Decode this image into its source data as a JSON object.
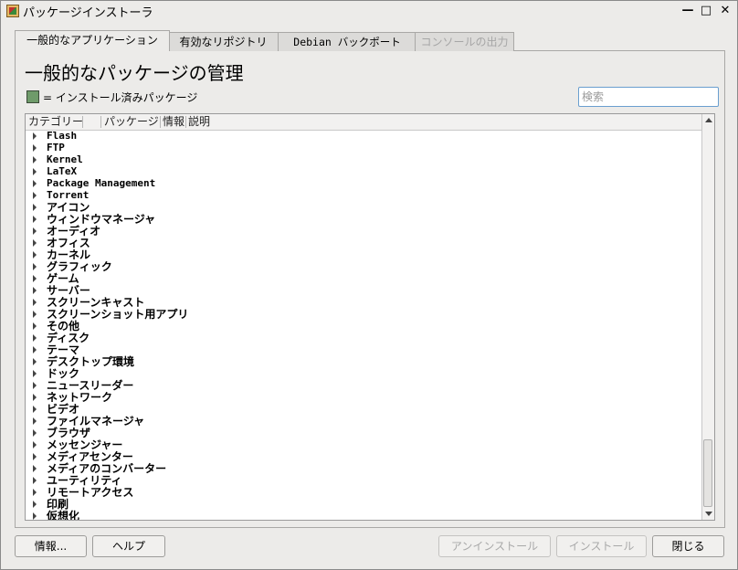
{
  "window": {
    "title": "パッケージインストーラ",
    "minimize_glyph": "—",
    "maximize_glyph": "□",
    "close_glyph": "✕"
  },
  "tabs": [
    {
      "label": "一般的なアプリケーション",
      "state": "active"
    },
    {
      "label": "有効なリポジトリ",
      "state": "normal"
    },
    {
      "label": "Debian バックポート",
      "state": "normal"
    },
    {
      "label": "コンソールの出力",
      "state": "disabled"
    }
  ],
  "main": {
    "page_title": "一般的なパッケージの管理",
    "legend_text": "= インストール済みパッケージ",
    "legend_color": "#6f9b6a",
    "search_placeholder": "検索",
    "search_value": ""
  },
  "tree": {
    "columns": [
      "カテゴリー",
      "パッケージ",
      "情報",
      "説明"
    ],
    "categories": [
      "Flash",
      "FTP",
      "Kernel",
      "LaTeX",
      "Package Management",
      "Torrent",
      "アイコン",
      "ウィンドウマネージャ",
      "オーディオ",
      "オフィス",
      "カーネル",
      "グラフィック",
      "ゲーム",
      "サーバー",
      "スクリーンキャスト",
      "スクリーンショット用アプリ",
      "その他",
      "ディスク",
      "テーマ",
      "デスクトップ環境",
      "ドック",
      "ニュースリーダー",
      "ネットワーク",
      "ビデオ",
      "ファイルマネージャ",
      "ブラウザ",
      "メッセンジャー",
      "メディアセンター",
      "メディアのコンバーター",
      "ユーティリティ",
      "リモートアクセス",
      "印刷",
      "仮想化"
    ]
  },
  "buttons": {
    "about": "情報...",
    "help": "ヘルプ",
    "uninstall": "アンインストール",
    "install": "インストール",
    "close": "閉じる"
  }
}
